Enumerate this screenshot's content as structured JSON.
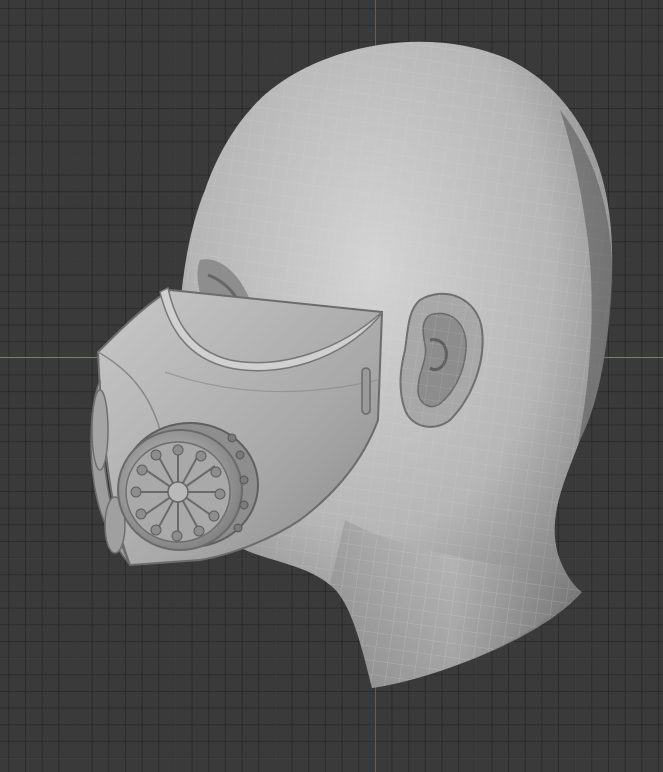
{
  "viewport": {
    "background_color": "#3a3a3a",
    "grid_color": "#4a4a4a",
    "x_axis_color": "#6f8f2c",
    "y_axis_color": "#2f6aa8"
  },
  "model": {
    "object": "head-with-respirator-mask",
    "shading": "solid-wireframe",
    "base_color": "#b5b5b5",
    "wire_color": "#d9d9d9"
  }
}
